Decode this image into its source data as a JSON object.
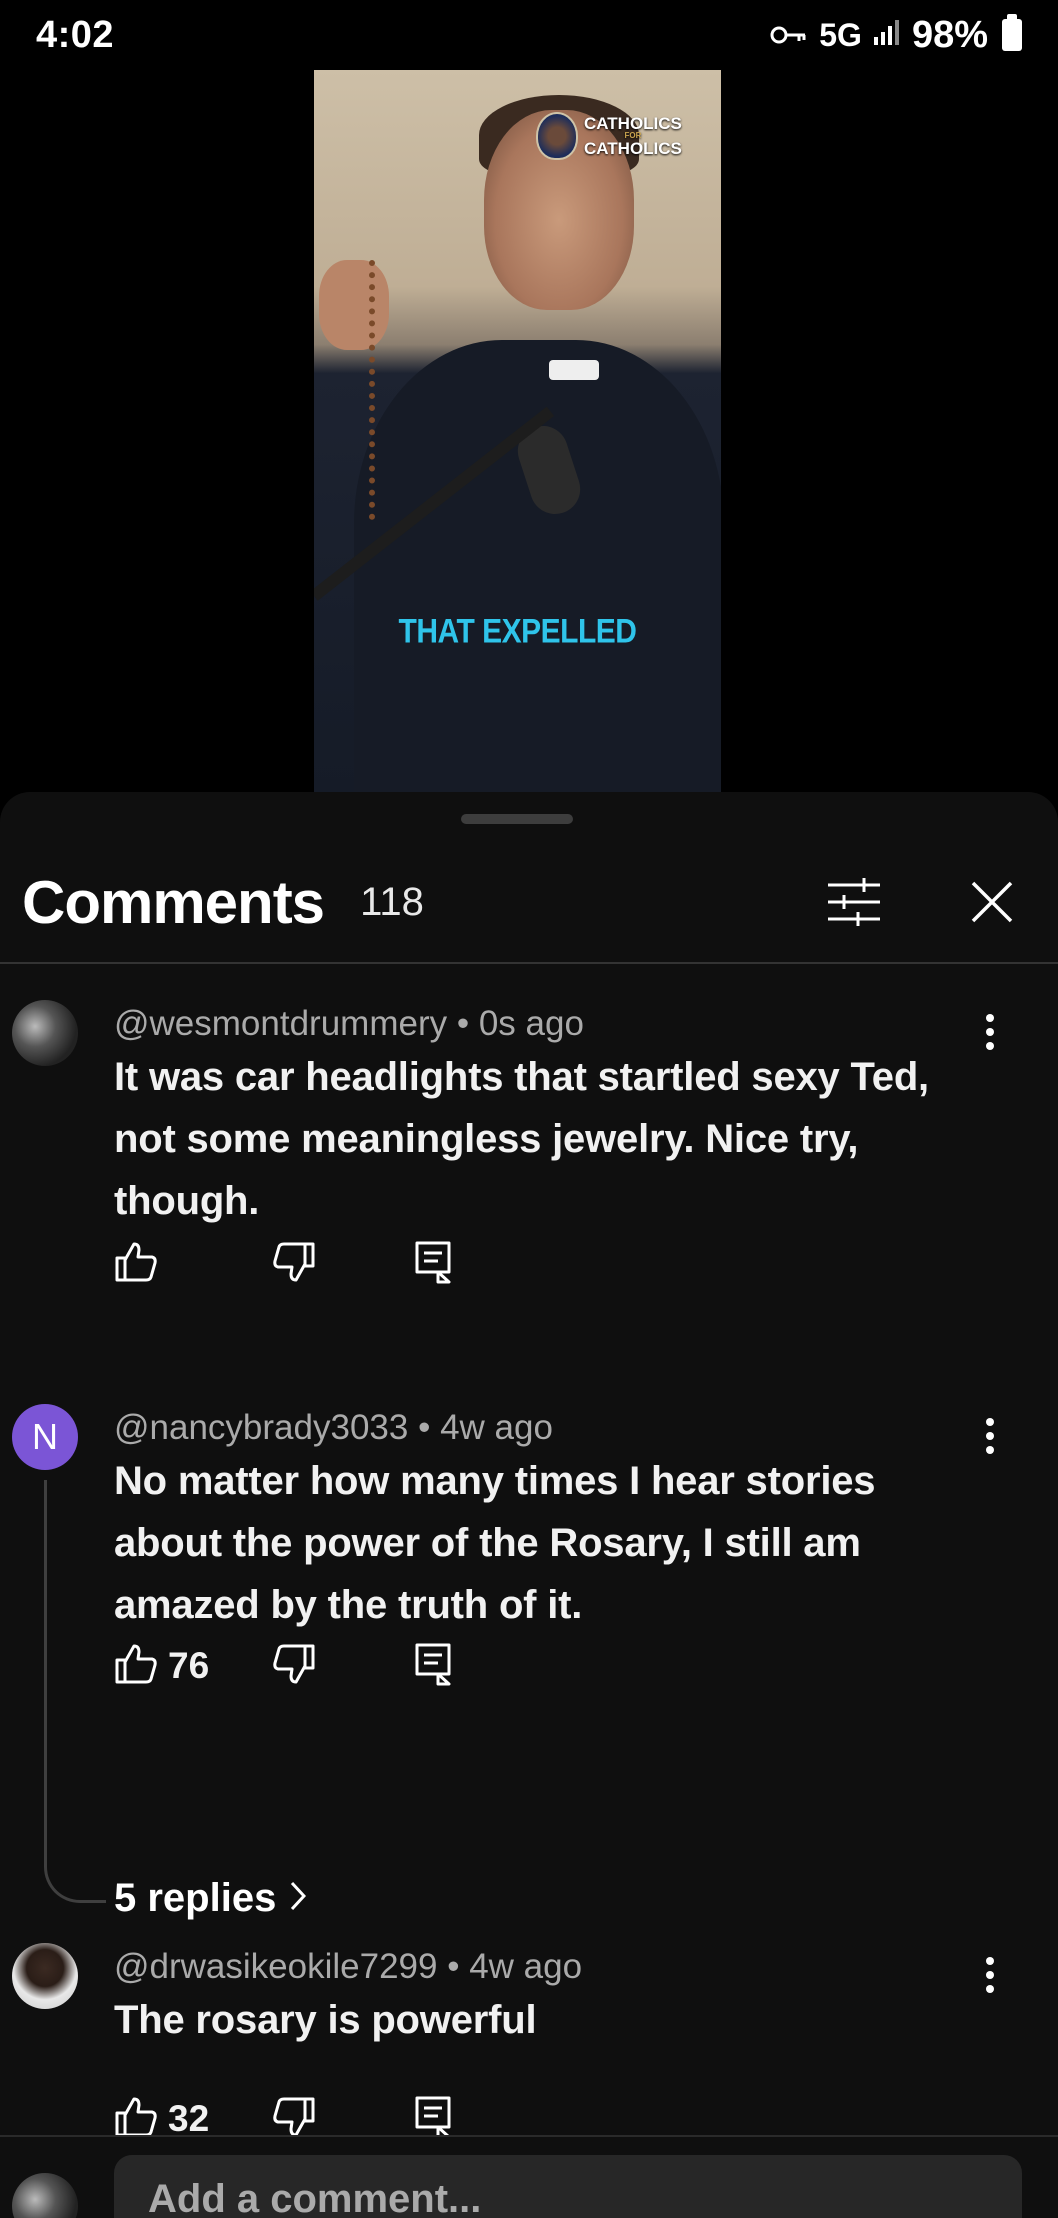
{
  "status_bar": {
    "time": "4:02",
    "network": "5G",
    "battery": "98%"
  },
  "video": {
    "logo_text_top": "CATHOLICS",
    "logo_text_mid": "FOR",
    "logo_text_bottom": "CATHOLICS",
    "caption": "THAT EXPELLED"
  },
  "comments_panel": {
    "title": "Comments",
    "count": "118",
    "sort_icon": "sort-filter-icon",
    "close_icon": "close-icon"
  },
  "comments": [
    {
      "author": "@wesmontdrummery",
      "time": "0s ago",
      "text": "It was car headlights that startled sexy Ted, not some meaningless jewelry. Nice try, though.",
      "likes": ""
    },
    {
      "author": "@nancybrady3033",
      "time": "4w ago",
      "avatar_letter": "N",
      "text": "No matter how many times I hear stories about the power of the Rosary, I still am amazed by the truth of it.",
      "likes": "76",
      "replies_label": "5 replies"
    },
    {
      "author": "@drwasikeokile7299",
      "time": "4w ago",
      "text": "The rosary is powerful",
      "likes": "32"
    }
  ],
  "add_comment": {
    "placeholder": "Add a comment..."
  },
  "colors": {
    "background": "#0f0f0f",
    "caption": "#2fc4ea",
    "avatar_letter_bg": "#7b55d6",
    "meta_text": "#aaaaaa"
  }
}
